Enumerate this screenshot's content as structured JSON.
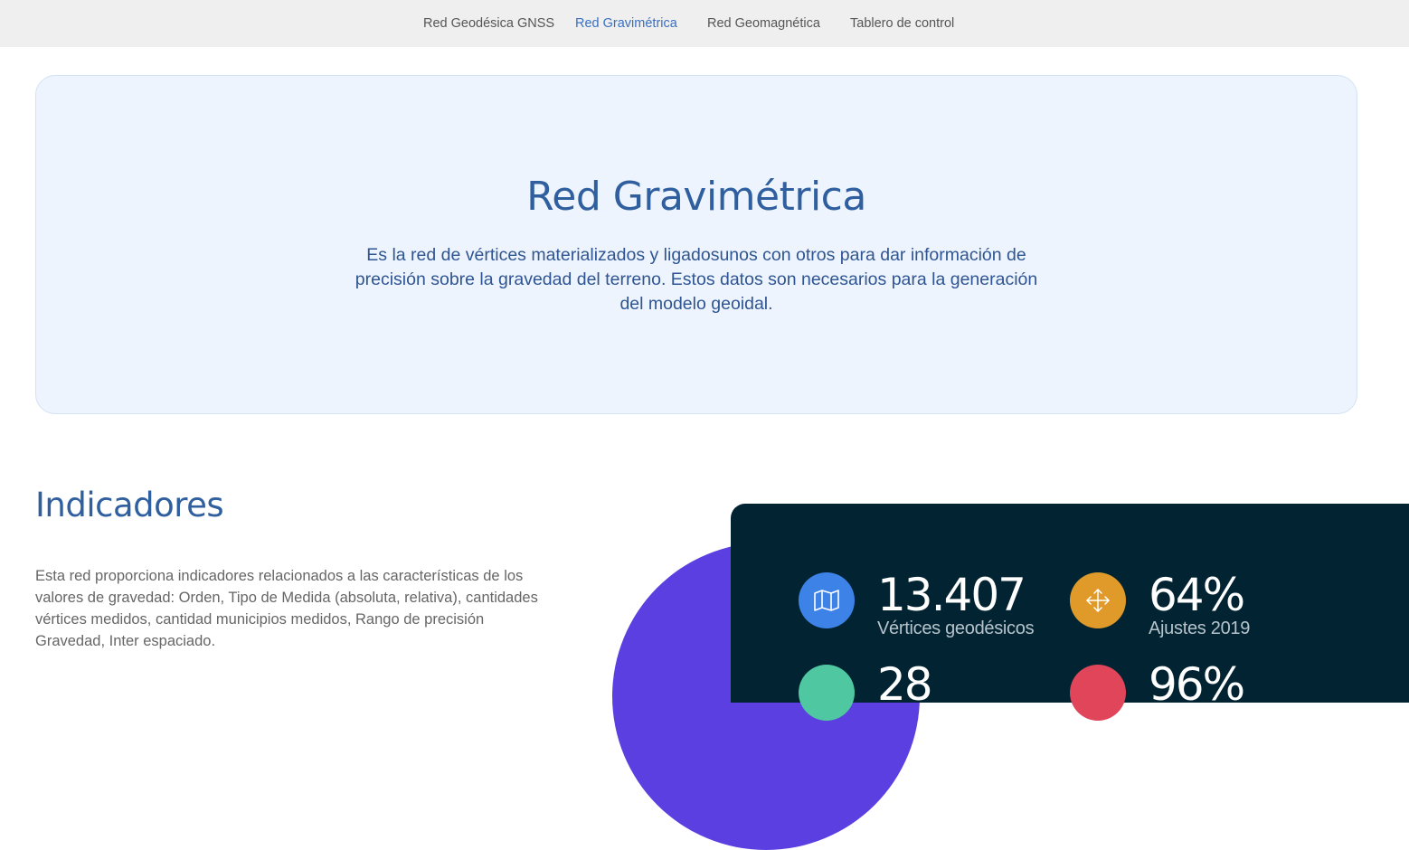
{
  "nav": {
    "items": [
      {
        "label": "Red Geodésica GNSS",
        "active": false
      },
      {
        "label": "Red Gravimétrica",
        "active": true
      },
      {
        "label": "Red Geomagnética",
        "active": false
      },
      {
        "label": "Tablero de control",
        "active": false
      }
    ]
  },
  "hero": {
    "title": "Red Gravimétrica",
    "description": "Es la red de vértices materializados y ligadosunos con otros para dar información de precisión sobre la gravedad del terreno. Estos datos son necesarios para la generación del modelo geoidal."
  },
  "indicators": {
    "title": "Indicadores",
    "description": "Esta red proporciona indicadores relacionados a las características de los valores de gravedad: Orden, Tipo de Medida (absoluta, relativa), cantidades vértices medidos, cantidad municipios medidos, Rango de precisión Gravedad, Inter espaciado.",
    "stats": [
      {
        "value": "13.407",
        "label": "Vértices geodésicos",
        "icon": "map-icon",
        "color": "#3d82e6"
      },
      {
        "value": "64%",
        "label": "Ajustes 2019",
        "icon": "move-arrows-icon",
        "color": "#e09a2a"
      },
      {
        "value": "28",
        "label": "",
        "icon": "partial-icon",
        "color": "#4fc7a0"
      },
      {
        "value": "96%",
        "label": "",
        "icon": "partial-icon",
        "color": "#e0455a"
      }
    ]
  },
  "colors": {
    "nav_bg": "#efefef",
    "nav_active": "#3a6fbf",
    "hero_bg": "#edf4fd",
    "heading": "#2f5f9e",
    "purple": "#5b3fe0",
    "dark_panel": "#022432"
  }
}
